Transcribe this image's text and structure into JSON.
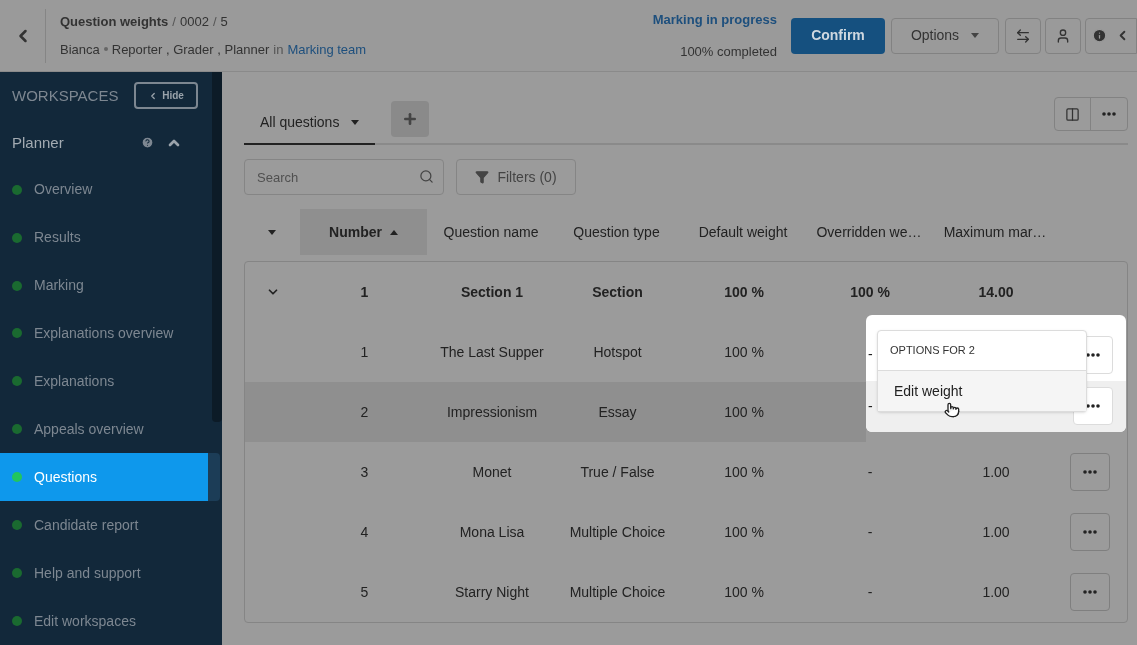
{
  "header": {
    "title": "Question weights",
    "crumbs": [
      "0002",
      "5"
    ],
    "separator": "/",
    "user": "Bianca",
    "roles": "Reporter , Grader , Planner",
    "in_word": "in",
    "team": "Marking team",
    "status": "Marking in progress",
    "progress": "100% completed",
    "confirm": "Confirm",
    "options": "Options"
  },
  "sidebar": {
    "heading": "WORKSPACES",
    "hide": "Hide",
    "group": "Planner",
    "expanded": true,
    "items": [
      {
        "label": "Overview",
        "selected": false
      },
      {
        "label": "Results",
        "selected": false
      },
      {
        "label": "Marking",
        "selected": false
      },
      {
        "label": "Explanations overview",
        "selected": false
      },
      {
        "label": "Explanations",
        "selected": false
      },
      {
        "label": "Appeals overview",
        "selected": false
      },
      {
        "label": "Questions",
        "selected": true
      },
      {
        "label": "Candidate report",
        "selected": false
      },
      {
        "label": "Help and support",
        "selected": false
      },
      {
        "label": "Edit workspaces",
        "selected": false
      }
    ]
  },
  "tabs": [
    {
      "label": "All questions",
      "selected": true
    }
  ],
  "search": {
    "placeholder": "Search"
  },
  "filters": "Filters (0)",
  "table": {
    "columns": [
      "Number",
      "Question name",
      "Question type",
      "Default weight",
      "Overridden we…",
      "Maximum mar…"
    ],
    "rows": [
      {
        "kind": "section",
        "number": "1",
        "name": "Section 1",
        "type": "Section",
        "default": "100 %",
        "overridden": "100 %",
        "max": "14.00",
        "selected": false,
        "spotlit": false
      },
      {
        "kind": "question",
        "number": "1",
        "name": "The Last Supper",
        "type": "Hotspot",
        "default": "100 %",
        "overridden": "-",
        "selected": false,
        "spotlit": true
      },
      {
        "kind": "question",
        "number": "2",
        "name": "Impressionism",
        "type": "Essay",
        "default": "100 %",
        "overridden": "-",
        "selected": true,
        "spotlit": true
      },
      {
        "kind": "question",
        "number": "3",
        "name": "Monet",
        "type": "True / False",
        "default": "100 %",
        "overridden": "-",
        "max": "1.00",
        "selected": false,
        "spotlit": false
      },
      {
        "kind": "question",
        "number": "4",
        "name": "Mona Lisa",
        "type": "Multiple Choice",
        "default": "100 %",
        "overridden": "-",
        "max": "1.00",
        "selected": false,
        "spotlit": false
      },
      {
        "kind": "question",
        "number": "5",
        "name": "Starry Night",
        "type": "Multiple Choice",
        "default": "100 %",
        "overridden": "-",
        "max": "1.00",
        "selected": false,
        "spotlit": false
      }
    ]
  },
  "menu": {
    "title": "OPTIONS FOR 2",
    "items": [
      "Edit weight"
    ]
  }
}
